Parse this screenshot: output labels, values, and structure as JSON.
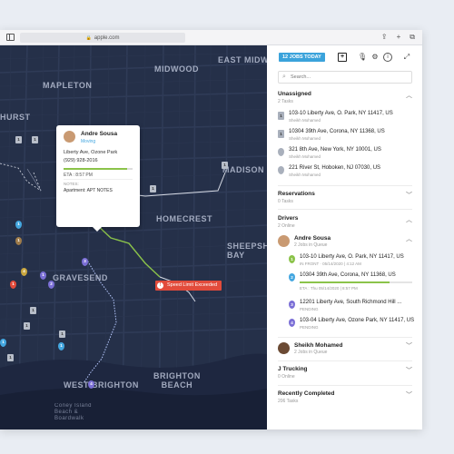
{
  "browser": {
    "url": "apple.com",
    "icons": [
      "share-icon",
      "plus-icon",
      "tabs-icon"
    ]
  },
  "map": {
    "labels": {
      "midwood": "MIDWOOD",
      "east_midwood": "EAST MIDWOOD",
      "mapleton": "MAPLETON",
      "madison": "MADISON",
      "homecrest": "HOMECREST",
      "gravesend": "GRAVESEND",
      "sheepshead_bay": "SHEEPSHEAD\nBAY",
      "west_brighton": "WEST BRIGHTON",
      "brighton_beach": "BRIGHTON\nBEACH",
      "hurst": "HURST",
      "coney_island": "Coney Island\nBeach &\nBoardwalk"
    },
    "popup": {
      "name": "Andre Sousa",
      "status": "Moving",
      "address": "Liberty Ave, Ozone Park",
      "phone": "(929) 928-2016",
      "progress": 0.92,
      "eta": "ETA : 8:57 PM",
      "notes_label": "NOTES:",
      "notes": "Apartment: APT NOTES"
    },
    "alert": {
      "text": "Speed Limit Exceeded",
      "icon": "!"
    },
    "colors": {
      "map_bg": "#253049",
      "route_green": "#8bc34a",
      "route_white": "#d8dce6",
      "alert_red": "#e24b3b"
    }
  },
  "panel": {
    "jobs_badge": "12 JOBS TODAY",
    "search_placeholder": "Search...",
    "unassigned": {
      "title": "Unassigned",
      "count": "2 Tasks",
      "items": [
        {
          "marker": "1",
          "title": "103-10 Liberty Ave, O. Park, NY 11417, US",
          "sub": "Sheikh Mohamed"
        },
        {
          "marker": "1",
          "title": "10304 39th Ave, Corona, NY 11368, US",
          "sub": "Sheikh Mohamed"
        },
        {
          "marker": "",
          "title": "321 8th Ave, New York, NY 10001, US",
          "sub": "Sheikh Mohamed"
        },
        {
          "marker": "",
          "title": "221 River St, Hoboken, NJ 07030, US",
          "sub": "Sheikh Mohamed"
        }
      ]
    },
    "reservations": {
      "title": "Reservations",
      "count": "0 Tasks"
    },
    "drivers": {
      "title": "Drivers",
      "count": "2 Online",
      "driver1": {
        "name": "Andre Sousa",
        "sub": "2 Jobs in Queue",
        "jobs": [
          {
            "marker": "1",
            "title": "103-10 Liberty Ave, O. Park, NY 11417, US",
            "sub": "IN FRONT · 05/14/2020 | 4:12 AM"
          },
          {
            "marker": "2",
            "title": "10304 39th Ave, Corona, NY 11368, US",
            "sub": "ETA : Thu 05/14/2020 | 8:57 PM",
            "progress": 0.8
          },
          {
            "marker": "3",
            "title": "12201 Liberty Ave, South Richmond Hill ...",
            "sub": "PENDING"
          },
          {
            "marker": "4",
            "title": "103-04 Liberty Ave, Ozone Park, NY 11417, US",
            "sub": "PENDING"
          }
        ]
      },
      "driver2": {
        "name": "Sheikh Mohamed",
        "sub": "2 Jobs in Queue"
      }
    },
    "j_trucking": {
      "title": "J Trucking",
      "count": "0 Online"
    },
    "recently_completed": {
      "title": "Recently Completed",
      "count": "206 Tasks"
    }
  }
}
